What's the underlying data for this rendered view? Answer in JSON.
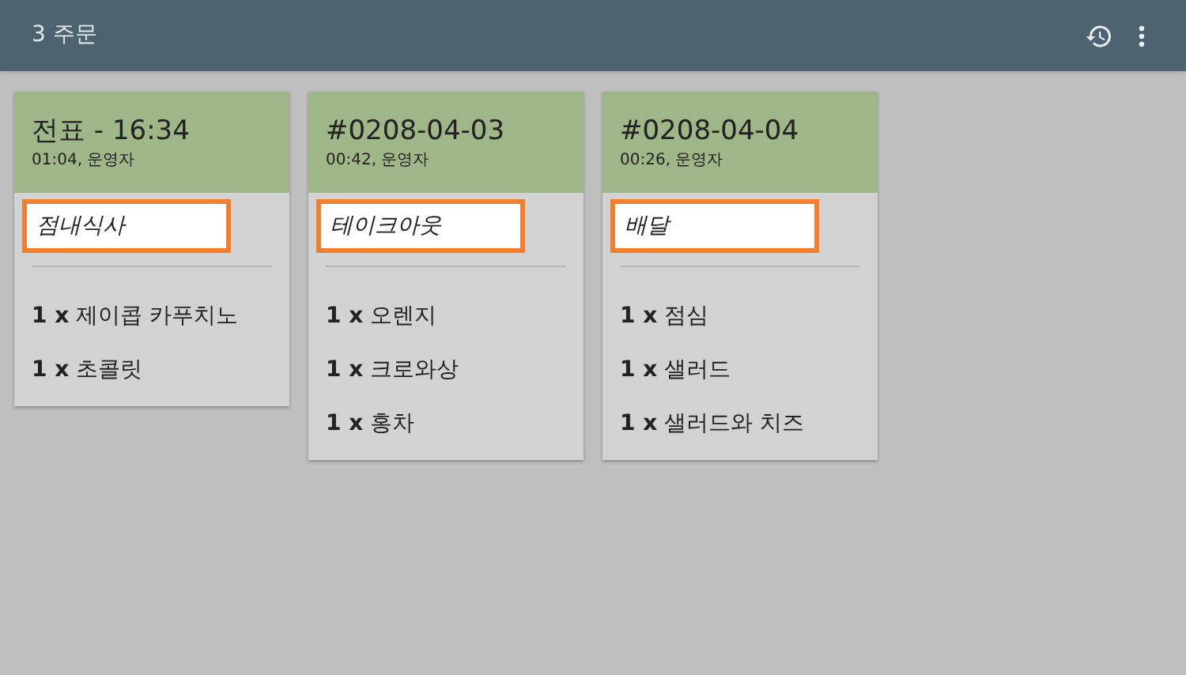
{
  "app_bar": {
    "title": "3 주문"
  },
  "orders": [
    {
      "title": "전표 - 16:34",
      "subtitle": "01:04, 운영자",
      "order_type": "점내식사",
      "items": [
        "**1 x** 제이콥 카푸치노",
        "**1 x** 초콜릿"
      ]
    },
    {
      "title": "#0208-04-03",
      "subtitle": "00:42, 운영자",
      "order_type": "테이크아웃",
      "items": [
        "**1 x** 오렌지",
        "**1 x** 크로와상",
        "**1 x** 홍차"
      ]
    },
    {
      "title": "#0208-04-04",
      "subtitle": "00:26, 운영자",
      "order_type": "배달",
      "items": [
        "**1 x** 점심",
        "**1 x** 샐러드",
        "**1 x** 샐러드와 치즈"
      ]
    }
  ]
}
